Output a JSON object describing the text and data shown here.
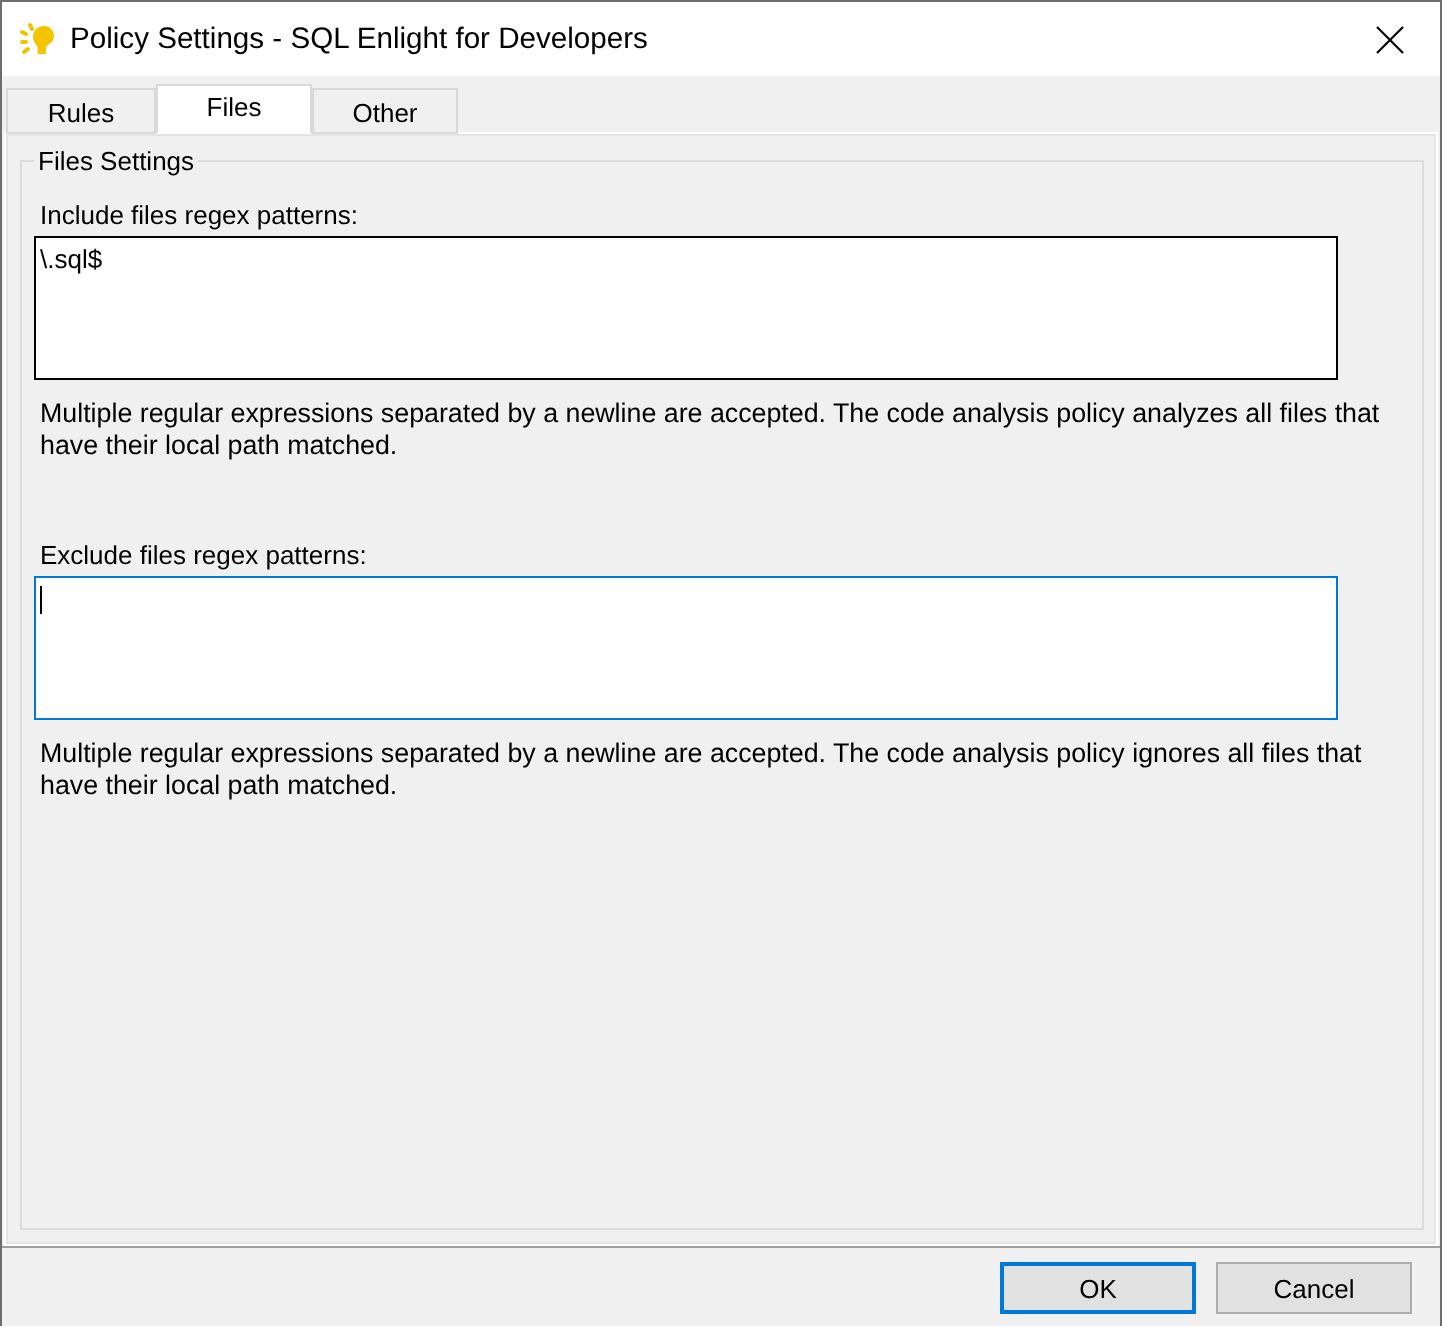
{
  "window": {
    "title": "Policy Settings - SQL Enlight for Developers"
  },
  "tabs": [
    {
      "label": "Rules",
      "selected": false
    },
    {
      "label": "Files",
      "selected": true
    },
    {
      "label": "Other",
      "selected": false
    }
  ],
  "group": {
    "title": "Files Settings",
    "fields": [
      {
        "label": "Include files regex patterns:",
        "value": "\\.sql$",
        "focused": false,
        "help": "Multiple regular expressions separated by a newline are accepted. The code analysis policy analyzes all files that have their local path matched."
      },
      {
        "label": "Exclude files regex patterns:",
        "focused": true,
        "help": "Multiple regular expressions separated by a newline are accepted. The code analysis policy ignores all files that have their local path matched."
      }
    ]
  },
  "buttons": [
    {
      "label": "OK",
      "default": true
    },
    {
      "label": "Cancel",
      "default": false
    }
  ]
}
